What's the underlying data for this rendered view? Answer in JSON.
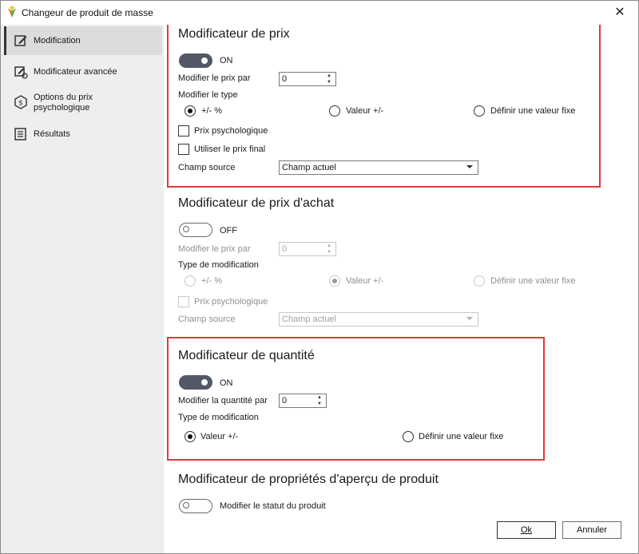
{
  "window": {
    "title": "Changeur de produit de masse",
    "close_glyph": "✕"
  },
  "sidebar": {
    "items": [
      {
        "label": "Modification",
        "icon": "edit-icon",
        "active": true
      },
      {
        "label": "Modificateur avancée",
        "icon": "advanced-edit-icon",
        "active": false
      },
      {
        "label": "Options du prix psychologique",
        "icon": "price-tag-icon",
        "active": false
      },
      {
        "label": "Résultats",
        "icon": "results-list-icon",
        "active": false
      }
    ]
  },
  "price_modifier": {
    "title": "Modificateur de prix",
    "toggle": "ON",
    "modify_by_label": "Modifier le prix par",
    "modify_by_value": "0",
    "type_label": "Modifier le type",
    "types": [
      "+/- %",
      "Valeur +/-",
      "Définir une valeur fixe"
    ],
    "selected_type": "+/- %",
    "psych_label": "Prix psychologique",
    "final_price_label": "Utiliser le prix final",
    "source_label": "Champ source",
    "source_value": "Champ actuel"
  },
  "purchase_price_modifier": {
    "title": "Modificateur de prix d'achat",
    "toggle": "OFF",
    "modify_by_label": "Modifier le prix par",
    "modify_by_value": "0",
    "type_label": "Type de modification",
    "types": [
      "+/- %",
      "Valeur +/-",
      "Définir une valeur fixe"
    ],
    "selected_type": "Valeur +/-",
    "psych_label": "Prix psychologique",
    "source_label": "Champ source",
    "source_value": "Champ actuel"
  },
  "quantity_modifier": {
    "title": "Modificateur de quantité",
    "toggle": "ON",
    "modify_by_label": "Modifier la quantité par",
    "modify_by_value": "0",
    "type_label": "Type de modification",
    "types": [
      "Valeur +/-",
      "Définir une valeur fixe"
    ],
    "selected_type": "Valeur +/-"
  },
  "preview_modifier": {
    "title": "Modificateur de propriétés d'aperçu de produit",
    "status_label": "Modifier le statut du produit"
  },
  "footer": {
    "ok_label": "Ok",
    "cancel_label": "Annuler"
  },
  "colors": {
    "highlight_border": "#e0393e",
    "toggle_on": "#525866",
    "sidebar_bg": "#eeeeee"
  }
}
